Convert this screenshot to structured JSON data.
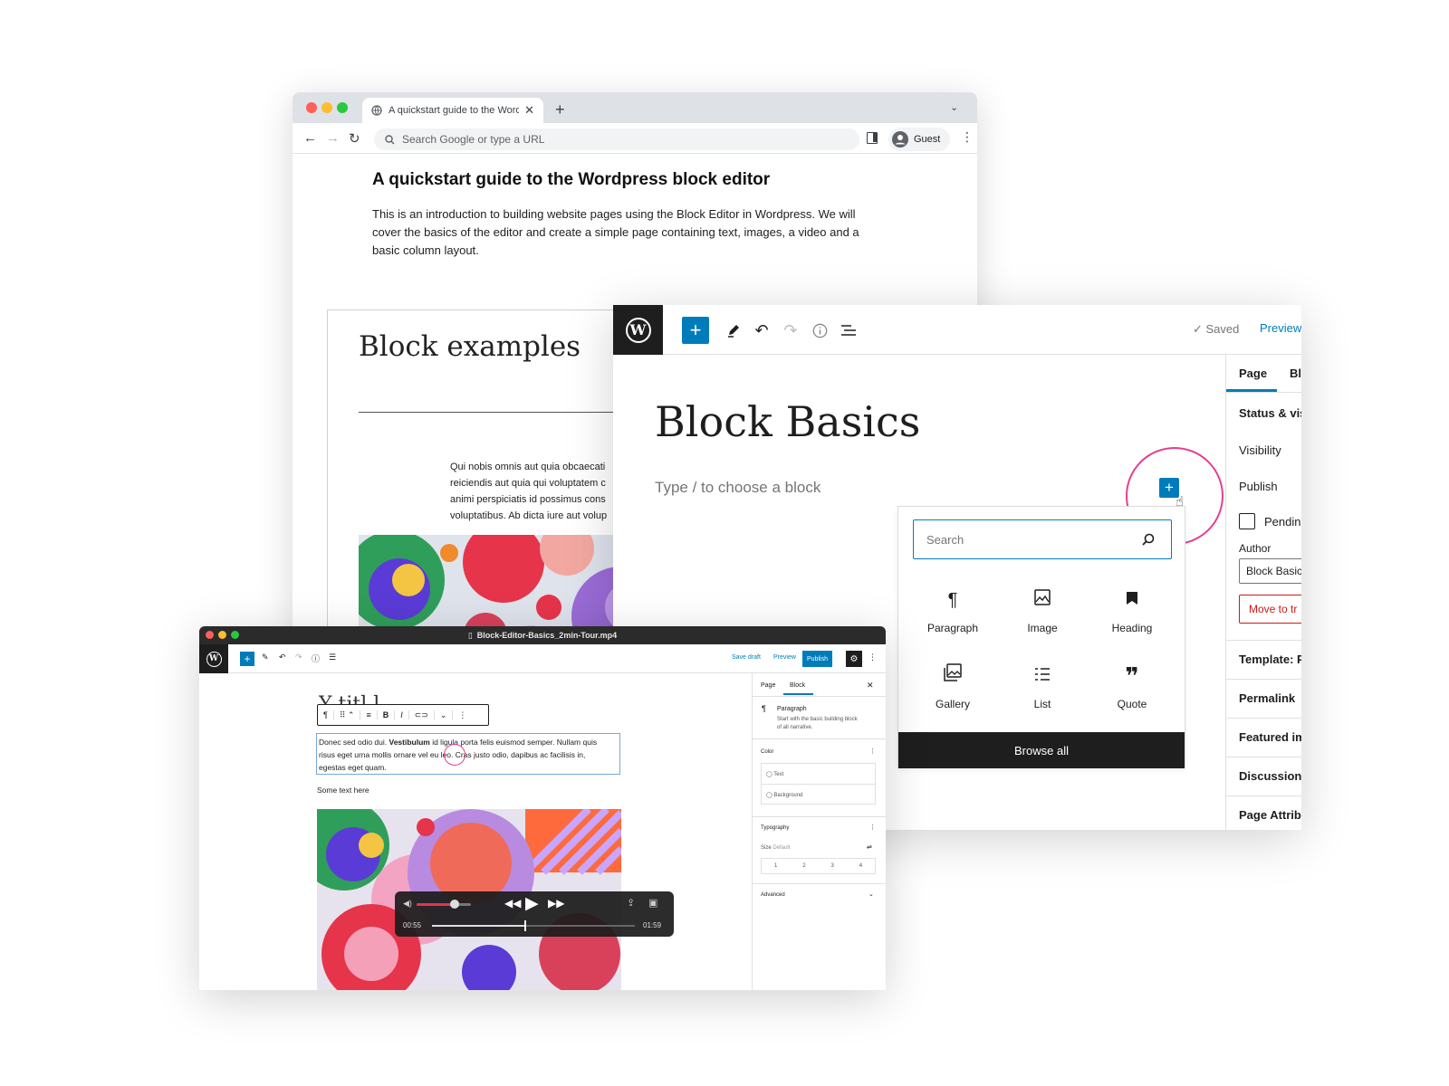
{
  "browser": {
    "tab_title": "A quickstart guide to the Word",
    "omnibox_placeholder": "Search Google or type a URL",
    "guest_label": "Guest",
    "heading": "A quickstart guide to the Wordpress block editor",
    "intro": "This is an introduction to building website pages using the Block Editor in Wordpress. We will cover the basics of the editor and create a simple page containing text, images, a video and a basic column layout.",
    "doc_title": "Block examples",
    "doc_lines": [
      "Qui nobis omnis aut quia obcaecati",
      "reiciendis aut quia qui voluptatem c",
      "animi perspiciatis id possimus cons",
      "voluptatibus. Ab dicta iure aut volup"
    ]
  },
  "editor": {
    "saved": "Saved",
    "preview": "Preview",
    "page_title": "Block Basics",
    "placeholder": "Type / to choose a block",
    "search_placeholder": "Search",
    "blocks": [
      {
        "label": "Paragraph",
        "icon": "paragraph-icon"
      },
      {
        "label": "Image",
        "icon": "image-icon"
      },
      {
        "label": "Heading",
        "icon": "heading-icon"
      },
      {
        "label": "Gallery",
        "icon": "gallery-icon"
      },
      {
        "label": "List",
        "icon": "list-icon"
      },
      {
        "label": "Quote",
        "icon": "quote-icon"
      }
    ],
    "browse_all": "Browse all",
    "sidebar": {
      "tab_page": "Page",
      "tab_block": "Bl",
      "status": "Status & vis",
      "visibility": "Visibility",
      "publish": "Publish",
      "pending": "Pendin",
      "author": "Author",
      "author_value": "Block Basic",
      "move_to_trash": "Move to tr",
      "template": "Template: P",
      "permalink": "Permalink",
      "featured": "Featured im",
      "discussion": "Discussion",
      "page_attributes": "Page Attrib"
    }
  },
  "video": {
    "filename": "Block-Editor-Basics_2min-Tour.mp4",
    "save_draft": "Save draft",
    "preview": "Preview",
    "publish": "Publish",
    "paragraph": {
      "line1_a": "Donec sed odio dui. ",
      "line1_b": "Vestibulum",
      "line1_c": " id ligula porta felis euismod semper. Nullam quis",
      "line2": "risus eget urna mollis ornare vel eu leo. Cras justo odio, dapibus ac facilisis in,",
      "line3": "egestas eget quam."
    },
    "some_text": "Some text here",
    "sidebar": {
      "tab_page": "Page",
      "tab_block": "Block",
      "block_name": "Paragraph",
      "block_desc_1": "Start with the basic building block",
      "block_desc_2": "of all narrative.",
      "color": "Color",
      "text": "Text",
      "background": "Background",
      "typography": "Typography",
      "size": "Size",
      "size_default": "Default",
      "sizes": [
        "1",
        "2",
        "3",
        "4"
      ],
      "advanced": "Advanced"
    },
    "player": {
      "current_time": "00:55",
      "duration": "01:59",
      "progress": 0.46,
      "volume": 0.7
    }
  },
  "colors": {
    "accent": "#007cba",
    "highlight_ring": "#e63e8f",
    "dark": "#1e1e1e"
  }
}
